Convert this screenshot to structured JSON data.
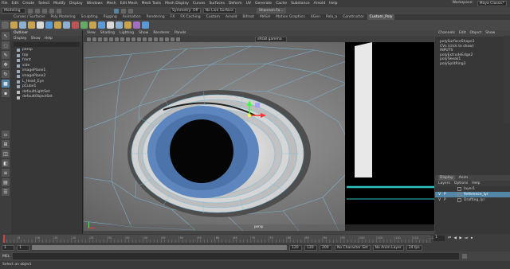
{
  "menubar": {
    "items": [
      "File",
      "Edit",
      "Create",
      "Select",
      "Modify",
      "Display",
      "Windows",
      "Mesh",
      "Edit Mesh",
      "Mesh Tools",
      "Mesh Display",
      "Curves",
      "Surfaces",
      "Deform",
      "UV",
      "Generate",
      "Cache",
      "Substance",
      "Arnold",
      "Help"
    ],
    "workspace_label": "Workspace:",
    "workspace_value": "Maya Classic*"
  },
  "statusline": {
    "mode": "Modeling",
    "symmetry": "Symmetry: Off",
    "live": "No Live Surface",
    "user": "Shannon Fo..."
  },
  "shelf_tabs": [
    "Curves / Surfaces",
    "Poly Modeling",
    "Sculpting",
    "Rigging",
    "Animation",
    "Rendering",
    "FX",
    "FX Caching",
    "Custom",
    "Arnold",
    "Bifrost",
    "MASH",
    "Motion Graphics",
    "XGen",
    "Polo_a",
    "Constructor",
    "Custom_Poly"
  ],
  "shelf_active": "Custom_Poly",
  "outliner": {
    "title": "Outliner",
    "menu": [
      "Display",
      "Show",
      "Help"
    ],
    "items": [
      "persp",
      "top",
      "front",
      "side",
      "imagePlane1",
      "imagePlane2",
      "L_Head_Eye",
      "pCube1",
      "defaultLightSet",
      "defaultObjectSet"
    ]
  },
  "viewport": {
    "menu": [
      "View",
      "Shading",
      "Lighting",
      "Show",
      "Renderer",
      "Panels"
    ],
    "gamma": "sRGB gamma",
    "camera": "persp"
  },
  "channelbox": {
    "tabs": [
      "Channels",
      "Edit",
      "Object",
      "Show"
    ],
    "object": "polySurfaceShape1",
    "lines": [
      "CVs (click to show)",
      "INPUTS",
      "polyExtrudeEdge2",
      "polyTweak1",
      "polySplitRing3"
    ]
  },
  "layers": {
    "tabs": [
      "Display",
      "Anim"
    ],
    "menu": [
      "Layers",
      "Options",
      "Help"
    ],
    "rows": [
      {
        "v": "",
        "p": "",
        "name": "layer1"
      },
      {
        "v": "V",
        "p": "P",
        "name": "Reference_lyr"
      },
      {
        "v": "V",
        "p": "P",
        "name": "Drafting_lyr"
      }
    ]
  },
  "timeline": {
    "ticks": [
      "5",
      "10",
      "15",
      "20",
      "25",
      "30",
      "35",
      "40",
      "45",
      "50",
      "55",
      "60",
      "65",
      "70",
      "75",
      "80",
      "85",
      "90",
      "95",
      "100",
      "105",
      "110",
      "115",
      "120"
    ],
    "current": "1",
    "frame_end": "120"
  },
  "range": {
    "start": "1",
    "start2": "1",
    "end1": "120",
    "end2": "120",
    "end3": "200",
    "char_set": "No Character Set",
    "anim_layer": "No Anim Layer",
    "fps": "24 fps"
  },
  "cmd": {
    "label": "MEL"
  },
  "help": {
    "text": "Select an object"
  },
  "colors": {
    "iris": "#5d86be",
    "accent": "#5285a6",
    "wire": "#7fbcd6"
  }
}
